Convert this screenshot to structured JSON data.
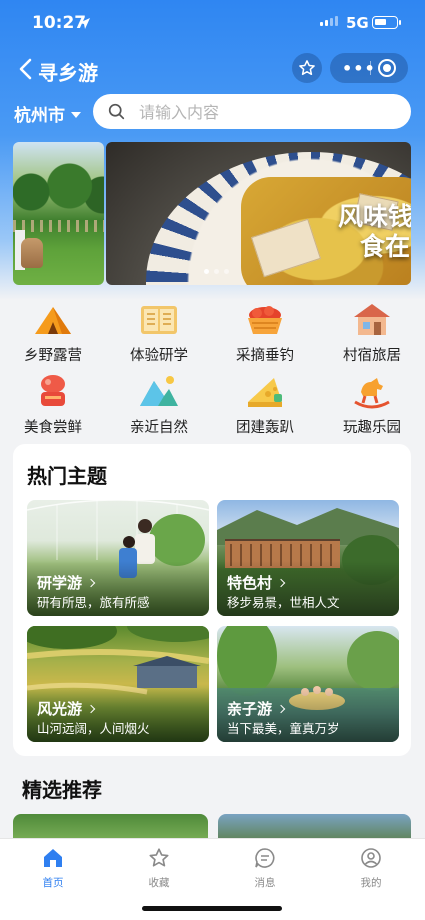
{
  "status_bar": {
    "time": "10:27",
    "network": "5G"
  },
  "nav": {
    "title": "寻乡游"
  },
  "location": {
    "city": "杭州市"
  },
  "search": {
    "placeholder": "请输入内容"
  },
  "banner": {
    "caption_line1": "风味钱",
    "caption_line2": "食在"
  },
  "categories": [
    {
      "label": "乡野露营",
      "icon": "tent-icon"
    },
    {
      "label": "体验研学",
      "icon": "book-icon"
    },
    {
      "label": "采摘垂钓",
      "icon": "fruit-basket-icon"
    },
    {
      "label": "村宿旅居",
      "icon": "house-icon"
    },
    {
      "label": "美食尝鲜",
      "icon": "food-icon"
    },
    {
      "label": "亲近自然",
      "icon": "mountain-icon"
    },
    {
      "label": "团建轰趴",
      "icon": "cheese-icon"
    },
    {
      "label": "玩趣乐园",
      "icon": "rocking-horse-icon"
    }
  ],
  "hot_topics": {
    "heading": "热门主题",
    "items": [
      {
        "title": "研学游",
        "subtitle": "研有所思，旅有所感"
      },
      {
        "title": "特色村",
        "subtitle": "移步易景，世相人文"
      },
      {
        "title": "风光游",
        "subtitle": "山河远阔，人间烟火"
      },
      {
        "title": "亲子游",
        "subtitle": "当下最美，童真万岁"
      }
    ]
  },
  "recommended": {
    "heading": "精选推荐"
  },
  "tabbar": {
    "items": [
      {
        "label": "首页",
        "icon": "home-icon",
        "active": true
      },
      {
        "label": "收藏",
        "icon": "star-icon",
        "active": false
      },
      {
        "label": "消息",
        "icon": "message-icon",
        "active": false
      },
      {
        "label": "我的",
        "icon": "user-icon",
        "active": false
      }
    ]
  },
  "colors": {
    "accent": "#2f7ff0",
    "header_top": "#2f86f2"
  }
}
